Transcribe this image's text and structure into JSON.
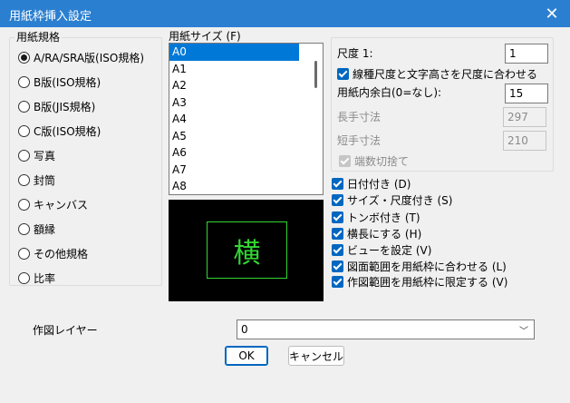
{
  "window": {
    "title": "用紙枠挿入設定",
    "close_glyph": "✕"
  },
  "paper_standard": {
    "label": "用紙規格",
    "options": [
      {
        "label": "A/RA/SRA版(ISO規格)",
        "selected": true
      },
      {
        "label": "B版(ISO規格)",
        "selected": false
      },
      {
        "label": "B版(JIS規格)",
        "selected": false
      },
      {
        "label": "C版(ISO規格)",
        "selected": false
      },
      {
        "label": "写真",
        "selected": false
      },
      {
        "label": "封筒",
        "selected": false
      },
      {
        "label": "キャンバス",
        "selected": false
      },
      {
        "label": "額縁",
        "selected": false
      },
      {
        "label": "その他規格",
        "selected": false
      },
      {
        "label": "比率",
        "selected": false
      }
    ]
  },
  "paper_size": {
    "label": "用紙サイズ (F)",
    "items": [
      "A0",
      "A1",
      "A2",
      "A3",
      "A4",
      "A5",
      "A6",
      "A7",
      "A8"
    ],
    "selected": "A0"
  },
  "preview": {
    "glyph": "横"
  },
  "scale": {
    "label": "尺度 1:",
    "value": "1",
    "linetype_check": {
      "label": "線種尺度と文字高さを尺度に合わせる",
      "checked": true
    }
  },
  "margin": {
    "label": "用紙内余白(0=なし):",
    "value": "15"
  },
  "long_side": {
    "label": "長手寸法",
    "value": "297"
  },
  "short_side": {
    "label": "短手寸法",
    "value": "210"
  },
  "round_off": {
    "label": "端数切捨て",
    "checked": true
  },
  "options": [
    {
      "label": "日付付き (D)",
      "checked": true
    },
    {
      "label": "サイズ・尺度付き (S)",
      "checked": true
    },
    {
      "label": "トンボ付き (T)",
      "checked": true
    },
    {
      "label": "横長にする (H)",
      "checked": true
    },
    {
      "label": "ビューを設定 (V)",
      "checked": true
    },
    {
      "label": "図面範囲を用紙枠に合わせる (L)",
      "checked": true
    },
    {
      "label": "作図範囲を用紙枠に限定する (V)",
      "checked": true
    }
  ],
  "layer": {
    "label": "作図レイヤー",
    "value": "0"
  },
  "buttons": {
    "ok": "OK",
    "cancel": "キャンセル"
  },
  "colors": {
    "title_bar": "#2b7fd0",
    "selection": "#0078d7",
    "checkbox": "#0067c0",
    "preview_frame": "#33d633"
  }
}
